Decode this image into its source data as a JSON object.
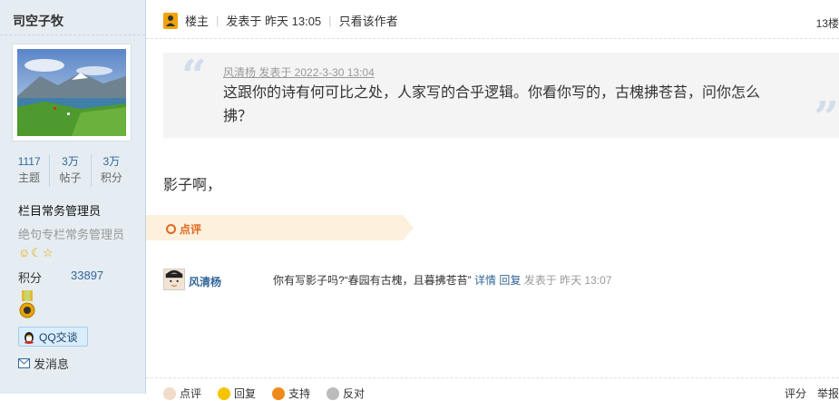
{
  "sidebar": {
    "username": "司空子牧",
    "stats": [
      {
        "value": "1117",
        "label": "主题"
      },
      {
        "value": "3万",
        "label": "帖子"
      },
      {
        "value": "3万",
        "label": "积分"
      }
    ],
    "rank": "栏目常务管理员",
    "group": "绝句专栏常务管理员",
    "points_label": "积分",
    "points_value": "33897",
    "qq_button": "QQ交谈",
    "message_link": "发消息"
  },
  "post": {
    "role": "楼主",
    "posted": "发表于 昨天 13:05",
    "only_author": "只看该作者",
    "floor": "13楼",
    "quote": {
      "meta": "风清杨 发表于 2022-3-30 13:04",
      "text": "这跟你的诗有何可比之处，人家写的合乎逻辑。你看你写的，古槐拂苍苔，问你怎么拂？"
    },
    "body": "影子啊，",
    "comment_section_label": "点评",
    "comment": {
      "user": "风清杨",
      "text": "你有写影子吗?“春园有古槐，且暮拂苍苔”",
      "detail_link": "详情",
      "reply_link": "回复",
      "meta": "发表于 昨天 13:07"
    },
    "footer": {
      "actions": [
        "点评",
        "回复",
        "支持",
        "反对"
      ],
      "right": [
        "评分",
        "举报"
      ]
    }
  },
  "colors": {
    "sidebar_bg": "#e5edf2",
    "link": "#336699",
    "accent_orange": "#e06a1f"
  }
}
